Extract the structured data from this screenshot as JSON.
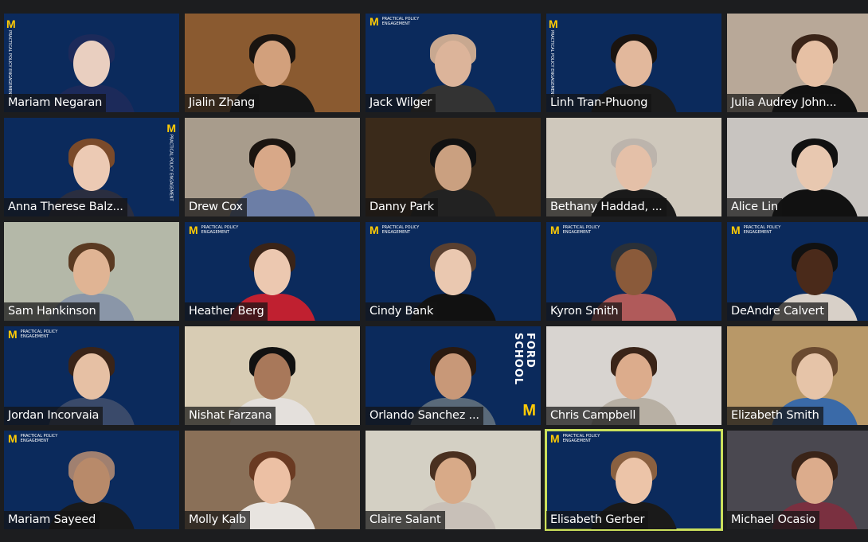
{
  "branding": {
    "m_letter": "M",
    "banner_text": "PRACTICAL POLICY ENGAGEMENT",
    "ford_text": "FORD SCHOOL"
  },
  "colors": {
    "brand_blue": "#0b2a5c",
    "maize": "#ffcb05",
    "active_speaker_border": "#cbe05c"
  },
  "active_speaker": "Elisabeth Gerber",
  "tiles": [
    {
      "name": "Mariam Negaran",
      "bg": "#0b2a5c",
      "logo": "left",
      "hair": "#1c2a5a",
      "skin": "#e9cfc0",
      "shirt": "#1c2a5a"
    },
    {
      "name": "Jialin Zhang",
      "bg": "#8a5a30",
      "logo": "none",
      "hair": "#1a1410",
      "skin": "#d2a07c",
      "shirt": "#151515"
    },
    {
      "name": "Jack Wilger",
      "bg": "#0b2a5c",
      "logo": "top",
      "hair": "#c8a890",
      "skin": "#dcb49a",
      "shirt": "#333333"
    },
    {
      "name": "Linh Tran-Phuong",
      "bg": "#0b2a5c",
      "logo": "left",
      "hair": "#1a1410",
      "skin": "#e2b89c",
      "shirt": "#1c1c1c"
    },
    {
      "name": "Julia Audrey John...",
      "bg": "#b8a898",
      "logo": "none",
      "hair": "#3a2418",
      "skin": "#e6c0a4",
      "shirt": "#111111"
    },
    {
      "name": "Anna Therese Balz...",
      "bg": "#0b2a5c",
      "logo": "right",
      "hair": "#7a4a2a",
      "skin": "#eccab4",
      "shirt": "#2a2e40"
    },
    {
      "name": "Drew Cox",
      "bg": "#a89c8c",
      "logo": "none",
      "hair": "#1a1410",
      "skin": "#d8a888",
      "shirt": "#6c7ea6"
    },
    {
      "name": "Danny Park",
      "bg": "#3a2a1a",
      "logo": "none",
      "hair": "#111111",
      "skin": "#caa080",
      "shirt": "#222222"
    },
    {
      "name": "Bethany Haddad, ...",
      "bg": "#cfc8bc",
      "logo": "none",
      "hair": "#bcb4ac",
      "skin": "#e4c0a8",
      "shirt": "#1a1a1a"
    },
    {
      "name": "Alice Lin",
      "bg": "#c8c4c0",
      "logo": "none",
      "hair": "#111111",
      "skin": "#e8c8b0",
      "shirt": "#111111"
    },
    {
      "name": "Sam Hankinson",
      "bg": "#b4b8a8",
      "logo": "none",
      "hair": "#5a3a22",
      "skin": "#e0b494",
      "shirt": "#8a96a8"
    },
    {
      "name": "Heather Berg",
      "bg": "#0b2a5c",
      "logo": "top",
      "hair": "#3a2418",
      "skin": "#ecc8b0",
      "shirt": "#c02030"
    },
    {
      "name": "Cindy Bank",
      "bg": "#0b2a5c",
      "logo": "top",
      "hair": "#5a4030",
      "skin": "#eac8b0",
      "shirt": "#111111"
    },
    {
      "name": "Kyron Smith",
      "bg": "#0b2a5c",
      "logo": "top",
      "hair": "#2a3038",
      "skin": "#8a5a3a",
      "shirt": "#b05a5a"
    },
    {
      "name": "DeAndre Calvert",
      "bg": "#0b2a5c",
      "logo": "top",
      "hair": "#111111",
      "skin": "#4a2a1a",
      "shirt": "#d8d0c8"
    },
    {
      "name": "Jordan Incorvaia",
      "bg": "#0b2a5c",
      "logo": "top",
      "hair": "#3a2418",
      "skin": "#e6c0a4",
      "shirt": "#3a4a6a"
    },
    {
      "name": "Nishat Farzana",
      "bg": "#d8ccb4",
      "logo": "none",
      "hair": "#111111",
      "skin": "#a8785a",
      "shirt": "#e4e0dc"
    },
    {
      "name": "Orlando Sanchez ...",
      "bg": "#0b2a5c",
      "logo": "ford",
      "hair": "#2a1a10",
      "skin": "#c89878",
      "shirt": "#5a6a7a"
    },
    {
      "name": "Chris Campbell",
      "bg": "#d8d4d0",
      "logo": "none",
      "hair": "#3a2418",
      "skin": "#dcac8c",
      "shirt": "#b8b0a4"
    },
    {
      "name": "Elizabeth Smith",
      "bg": "#b89868",
      "logo": "none",
      "hair": "#6a4a30",
      "skin": "#e6c4a8",
      "shirt": "#3a6aa8"
    },
    {
      "name": "Mariam Sayeed",
      "bg": "#0b2a5c",
      "logo": "top",
      "hair": "#a08070",
      "skin": "#b88a6a",
      "shirt": "#1a1a1a"
    },
    {
      "name": "Molly Kalb",
      "bg": "#8a7058",
      "logo": "none",
      "hair": "#6a3a22",
      "skin": "#ecc0a4",
      "shirt": "#e8e4e0"
    },
    {
      "name": "Claire Salant",
      "bg": "#d4d0c4",
      "logo": "none",
      "hair": "#4a3020",
      "skin": "#d8aa88",
      "shirt": "#c8c0b8"
    },
    {
      "name": "Elisabeth Gerber",
      "bg": "#0b2a5c",
      "logo": "top",
      "hair": "#8a6040",
      "skin": "#ecc4a8",
      "shirt": "#1a1a1a",
      "active": true
    },
    {
      "name": "Michael Ocasio",
      "bg": "#4a4850",
      "logo": "none",
      "hair": "#3a2418",
      "skin": "#dcac8c",
      "shirt": "#7a3040"
    }
  ]
}
